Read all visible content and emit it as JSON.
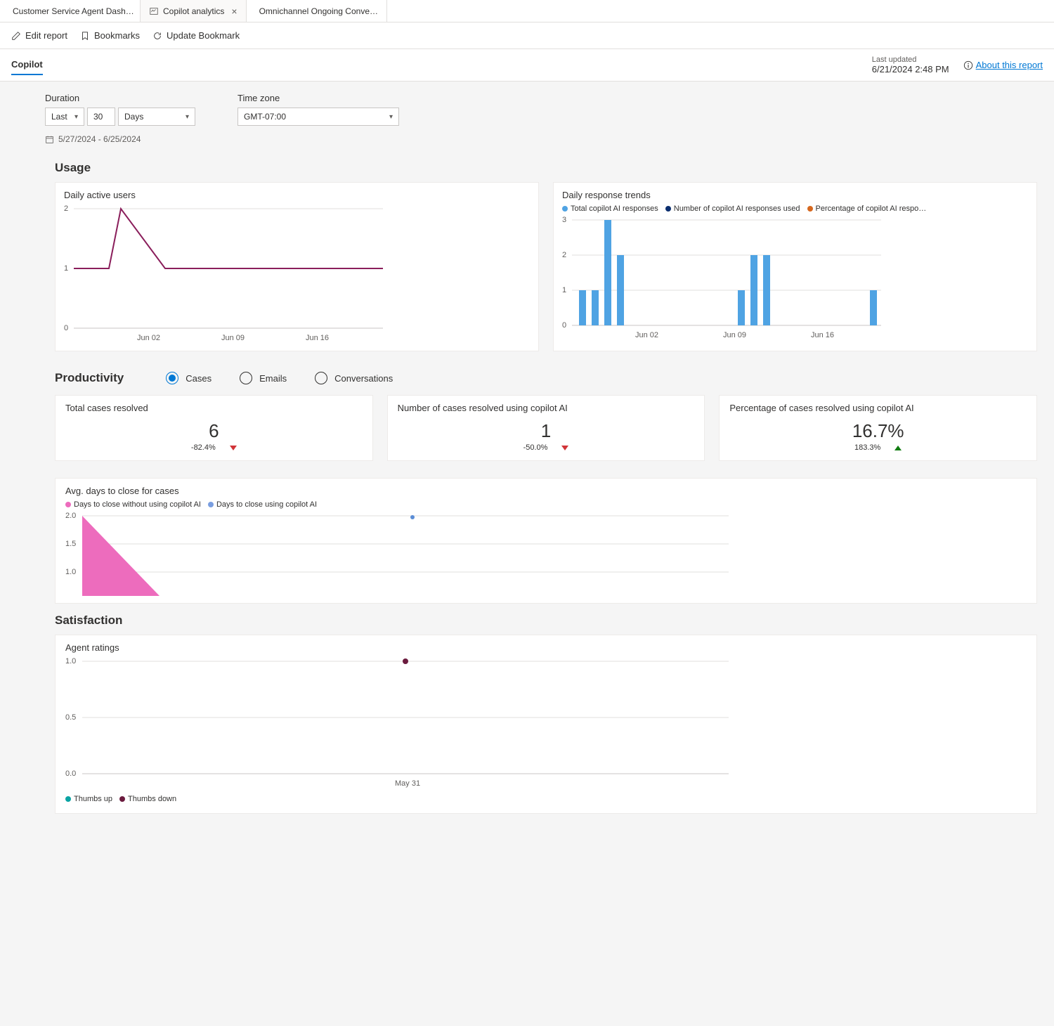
{
  "tabs": {
    "items": [
      {
        "label": "Customer Service Agent Dash…",
        "active": false,
        "closable": false
      },
      {
        "label": "Copilot analytics",
        "active": true,
        "closable": true
      },
      {
        "label": "Omnichannel Ongoing Conve…",
        "active": false,
        "closable": false
      }
    ]
  },
  "toolbar": {
    "edit": "Edit report",
    "bookmarks": "Bookmarks",
    "update": "Update Bookmark"
  },
  "subheader": {
    "tab": "Copilot",
    "last_updated_label": "Last updated",
    "last_updated_value": "6/21/2024 2:48 PM",
    "about": "About this report"
  },
  "filters": {
    "duration_label": "Duration",
    "duration_mode": "Last",
    "duration_value": "30",
    "duration_unit": "Days",
    "date_range": "5/27/2024 - 6/25/2024",
    "timezone_label": "Time zone",
    "timezone_value": "GMT-07:00"
  },
  "sections": {
    "usage": "Usage",
    "productivity": "Productivity",
    "satisfaction": "Satisfaction"
  },
  "usage": {
    "dau": {
      "title": "Daily active users",
      "y_ticks": [
        "2",
        "1",
        "0"
      ],
      "x_ticks": [
        "Jun 02",
        "Jun 09",
        "Jun 16"
      ]
    },
    "drt": {
      "title": "Daily response trends",
      "legend": [
        {
          "label": "Total copilot AI responses",
          "color": "#4fa3e3"
        },
        {
          "label": "Number of copilot AI responses used",
          "color": "#0b2e6f"
        },
        {
          "label": "Percentage of copilot AI respo…",
          "color": "#d6681f"
        }
      ],
      "y_ticks": [
        "3",
        "2",
        "1",
        "0"
      ],
      "x_ticks": [
        "Jun 02",
        "Jun 09",
        "Jun 16"
      ]
    }
  },
  "productivity": {
    "radios": [
      {
        "label": "Cases",
        "value": "cases",
        "selected": true
      },
      {
        "label": "Emails",
        "value": "emails",
        "selected": false
      },
      {
        "label": "Conversations",
        "value": "conversations",
        "selected": false
      }
    ],
    "kpis": [
      {
        "title": "Total cases resolved",
        "value": "6",
        "delta": "-82.4%",
        "direction": "down"
      },
      {
        "title": "Number of cases resolved using copilot AI",
        "value": "1",
        "delta": "-50.0%",
        "direction": "down"
      },
      {
        "title": "Percentage of cases resolved using copilot AI",
        "value": "16.7%",
        "delta": "183.3%",
        "direction": "up"
      }
    ],
    "avg_days": {
      "title": "Avg. days to close for cases",
      "legend": [
        {
          "label": "Days to close without using copilot AI",
          "color": "#ed6cbd"
        },
        {
          "label": "Days to close using copilot AI",
          "color": "#7a9ee0"
        }
      ],
      "y_ticks": [
        "2.0",
        "1.5",
        "1.0"
      ]
    }
  },
  "satisfaction": {
    "title": "Agent ratings",
    "y_ticks": [
      "1.0",
      "0.5",
      "0.0"
    ],
    "x_ticks": [
      "May 31"
    ],
    "legend": [
      {
        "label": "Thumbs up",
        "color": "#0aa3a3"
      },
      {
        "label": "Thumbs down",
        "color": "#6b1b3e"
      }
    ]
  },
  "chart_data": [
    {
      "id": "daily_active_users",
      "type": "line",
      "title": "Daily active users",
      "x": [
        "May 27",
        "May 28",
        "May 29",
        "May 30",
        "May 31",
        "Jun 01",
        "Jun 02",
        "Jun 03",
        "Jun 04",
        "Jun 05",
        "Jun 06",
        "Jun 07",
        "Jun 08",
        "Jun 09",
        "Jun 10",
        "Jun 11",
        "Jun 12",
        "Jun 13",
        "Jun 14",
        "Jun 15",
        "Jun 16",
        "Jun 17",
        "Jun 18",
        "Jun 19",
        "Jun 20",
        "Jun 21"
      ],
      "values": [
        1,
        1,
        1,
        2,
        1,
        1,
        1,
        1,
        1,
        1,
        1,
        1,
        1,
        1,
        1,
        1,
        1,
        1,
        1,
        1,
        1,
        1,
        1,
        1,
        1,
        1
      ],
      "ylim": [
        0,
        2
      ],
      "x_ticks_shown": [
        "Jun 02",
        "Jun 09",
        "Jun 16"
      ]
    },
    {
      "id": "daily_response_trends",
      "type": "bar",
      "title": "Daily response trends",
      "categories": [
        "May 28",
        "May 29",
        "May 30",
        "May 31",
        "Jun 09",
        "Jun 10",
        "Jun 11",
        "Jun 21"
      ],
      "series": [
        {
          "name": "Total copilot AI responses",
          "values": [
            1,
            1,
            3,
            2,
            1,
            2,
            2,
            1
          ]
        }
      ],
      "ylim": [
        0,
        3
      ],
      "x_ticks_shown": [
        "Jun 02",
        "Jun 09",
        "Jun 16"
      ],
      "legend": [
        "Total copilot AI responses",
        "Number of copilot AI responses used",
        "Percentage of copilot AI responses used"
      ]
    },
    {
      "id": "avg_days_to_close",
      "type": "area",
      "title": "Avg. days to close for cases",
      "series": [
        {
          "name": "Days to close without using copilot AI",
          "x": [
            "May 27",
            "May 30"
          ],
          "values": [
            2.0,
            0.5
          ]
        },
        {
          "name": "Days to close using copilot AI",
          "x": [
            "Jun 02"
          ],
          "values": [
            2.0
          ],
          "style": "point"
        }
      ],
      "ylim": [
        0.5,
        2.0
      ]
    },
    {
      "id": "agent_ratings",
      "type": "scatter",
      "title": "Agent ratings",
      "series": [
        {
          "name": "Thumbs up",
          "x": [],
          "values": []
        },
        {
          "name": "Thumbs down",
          "x": [
            "May 31"
          ],
          "values": [
            1.0
          ]
        }
      ],
      "ylim": [
        0.0,
        1.0
      ],
      "x_ticks_shown": [
        "May 31"
      ]
    }
  ]
}
